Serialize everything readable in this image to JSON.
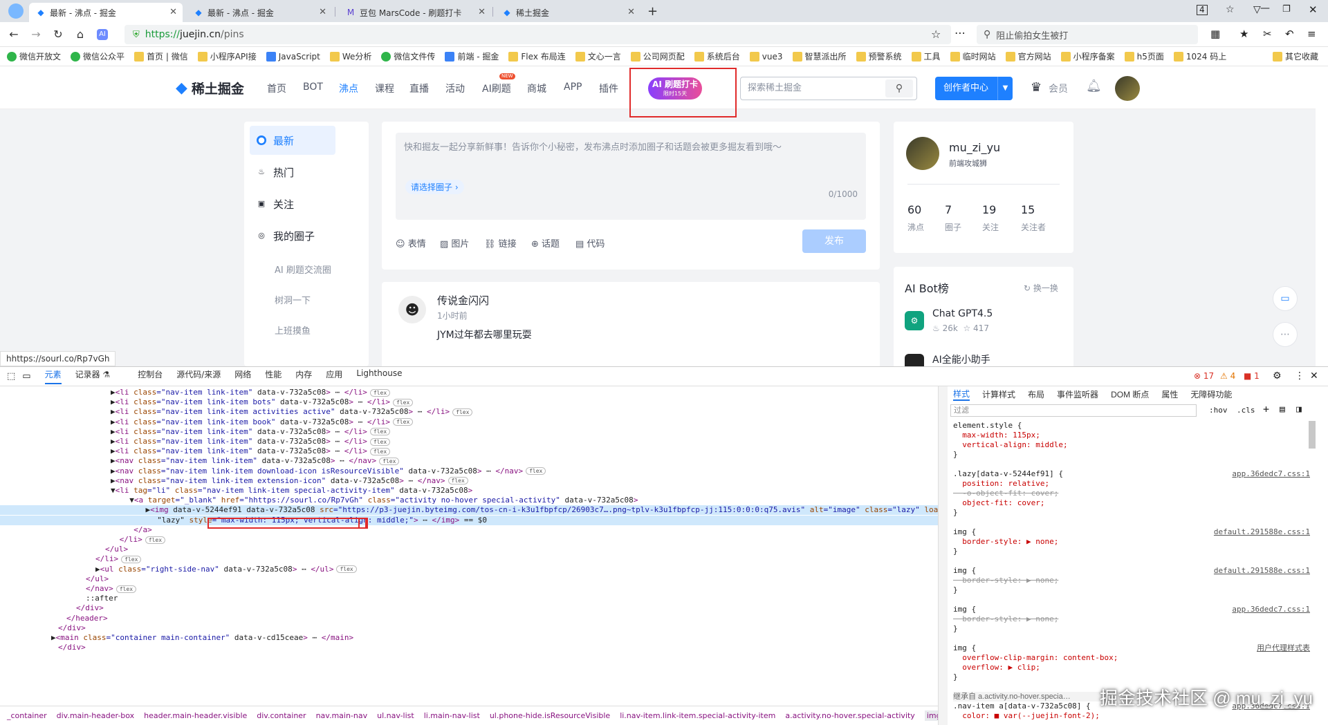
{
  "tabs": [
    {
      "label": "最新 - 沸点 - 掘金",
      "active": true
    },
    {
      "label": "最新 - 沸点 - 掘金",
      "active": false
    },
    {
      "label": "豆包 MarsCode - 刷题打卡",
      "active": false
    },
    {
      "label": "稀土掘金",
      "active": false
    }
  ],
  "address": {
    "protocol": "https://",
    "host": "juejin.cn",
    "path": "/pins",
    "search_placeholder": "阻止偷拍女生被打"
  },
  "bookmarks": [
    "微信开放文",
    "微信公众平",
    "首页 | 微信",
    "小程序API接",
    "JavaScript",
    "We分析",
    "微信文件传",
    "前端 - 掘金",
    "Flex 布局连",
    "文心一言",
    "公司网页配",
    "系统后台",
    "vue3",
    "智慧派出所",
    "预警系统",
    "工具",
    "临时网站",
    "官方网站",
    "小程序备案",
    "h5页面",
    "1024 码上",
    "其它收藏"
  ],
  "site": {
    "logo": "稀土掘金",
    "nav": [
      "首页",
      "BOT",
      "沸点",
      "课程",
      "直播",
      "活动",
      "AI刷题",
      "商城",
      "APP",
      "插件"
    ],
    "nav_active": "沸点",
    "new_badge": "NEW",
    "ai_badge": {
      "title": "AI 刷题打卡",
      "sub": "限时15天"
    },
    "search_placeholder": "探索稀土掘金",
    "creator_btn": "创作者中心",
    "vip": "会员",
    "sidebar": {
      "items": [
        "最新",
        "热门",
        "关注",
        "我的圈子"
      ],
      "sub": [
        "AI 刷题交流圈",
        "树洞一下",
        "上班摸鱼"
      ]
    },
    "composer": {
      "placeholder": "快和掘友一起分享新鲜事！告诉你个小秘密，发布沸点时添加圈子和话题会被更多掘友看到哦～",
      "circle": "请选择圈子 ›",
      "count": "0/1000",
      "tools": [
        "表情",
        "图片",
        "链接",
        "话题",
        "代码"
      ],
      "publish": "发布"
    },
    "post": {
      "author": "传说金闪闪",
      "time": "1小时前",
      "content": "JYM过年都去哪里玩耍"
    },
    "profile": {
      "name": "mu_zi_yu",
      "title": "前端攻城狮",
      "stats": [
        {
          "v": "60",
          "l": "沸点"
        },
        {
          "v": "7",
          "l": "圈子"
        },
        {
          "v": "19",
          "l": "关注"
        },
        {
          "v": "15",
          "l": "关注者"
        }
      ]
    },
    "bots": {
      "title": "AI Bot榜",
      "refresh": "换一换",
      "items": [
        {
          "name": "Chat GPT4.5",
          "hot": "26k",
          "star": "417"
        },
        {
          "name": "AI全能小助手",
          "hot": "",
          "star": ""
        }
      ]
    }
  },
  "status_url": "hhttps://sourl.co/Rp7vGh",
  "devtools": {
    "tabs": [
      "元素",
      "记录器 ⚗",
      "控制台",
      "源代码/来源",
      "网络",
      "性能",
      "内存",
      "应用",
      "Lighthouse"
    ],
    "errors": "17",
    "warnings": "4",
    "info": "1",
    "style_tabs": [
      "样式",
      "计算样式",
      "布局",
      "事件监听器",
      "DOM 断点",
      "属性",
      "无障碍功能"
    ],
    "filter_placeholder": "过滤",
    "hov": ":hov",
    "cls": ".cls",
    "crumbs": [
      "_container",
      "div.main-header-box",
      "header.main-header.visible",
      "div.container",
      "nav.main-nav",
      "ul.nav-list",
      "li.main-nav-list",
      "ul.phone-hide.isResourceVisible",
      "li.nav-item.link-item.special-activity-item",
      "a.activity.no-hover.special-activity",
      "img.lazy"
    ],
    "code": [
      "▶<li class=\"nav-item link-item\" data-v-732a5c08> ⋯ </li>",
      "▶<li class=\"nav-item link-item bots\" data-v-732a5c08> ⋯ </li>",
      "▶<li class=\"nav-item link-item activities active\" data-v-732a5c08> ⋯ </li>",
      "▶<li class=\"nav-item link-item book\" data-v-732a5c08> ⋯ </li>",
      "▶<li class=\"nav-item link-item\" data-v-732a5c08> ⋯ </li>",
      "▶<li class=\"nav-item link-item\" data-v-732a5c08> ⋯ </li>",
      "▶<li class=\"nav-item link-item\" data-v-732a5c08> ⋯ </li>",
      "▶<nav class=\"nav-item link-item\" data-v-732a5c08> ⋯ </nav>",
      "▶<nav class=\"nav-item link-item download-icon isResourceVisible\" data-v-732a5c08> ⋯ </nav>",
      "▶<nav class=\"nav-item link-item extension-icon\" data-v-732a5c08> ⋯ </nav>",
      "▼<li tag=\"li\" class=\"nav-item link-item special-activity-item\" data-v-732a5c08>",
      "  ▼<a target=\"_blank\" href=\"hhttps://sourl.co/Rp7vGh\" class=\"activity no-hover special-activity\" data-v-732a5c08>",
      "    ▶<img data-v-5244ef91 data-v-732a5c08 src=\"https://p3-juejin.byteimg.com/tos-cn-i-k3u1fbpfcp/26903c7….png~tplv-k3u1fbpfcp-jj:115:0:0:0:q75.avis\" alt=\"image\" class=\"lazy\" loading=",
      "     \"lazy\" style=\"max-width: 115px; vertical-align: middle;\"> ⋯ </img> == $0",
      "  </a>",
      " </li>",
      "</ul>",
      "</li>",
      "▶<ul class=\"right-side-nav\" data-v-732a5c08> ⋯ </ul>",
      "</ul>",
      "</nav>",
      "::after",
      "</div>",
      "</header>",
      "</div>",
      "▶<main class=\"container main-container\" data-v-cd15ceae> ⋯ </main>",
      "</div>"
    ],
    "styles": [
      {
        "t": "sel",
        "text": "element.style {"
      },
      {
        "t": "prop",
        "text": "  max-width: 115px;"
      },
      {
        "t": "prop",
        "text": "  vertical-align: middle;"
      },
      {
        "t": "close",
        "text": "}"
      },
      {
        "t": "sel",
        "text": ".lazy[data-v-5244ef91] {",
        "src": "app.36dedc7.css:1"
      },
      {
        "t": "prop",
        "text": "  position: relative;"
      },
      {
        "t": "strike",
        "text": "  -o-object-fit: cover;"
      },
      {
        "t": "prop",
        "text": "  object-fit: cover;"
      },
      {
        "t": "close",
        "text": "}"
      },
      {
        "t": "sel",
        "text": "img {",
        "src": "default.291588e.css:1"
      },
      {
        "t": "prop",
        "text": "  border-style: ▶ none;"
      },
      {
        "t": "close",
        "text": "}"
      },
      {
        "t": "sel",
        "text": "img {",
        "src": "default.291588e.css:1"
      },
      {
        "t": "strike",
        "text": "  border-style: ▶ none;"
      },
      {
        "t": "close",
        "text": "}"
      },
      {
        "t": "sel",
        "text": "img {",
        "src": "app.36dedc7.css:1"
      },
      {
        "t": "strike",
        "text": "  border-style: ▶ none;"
      },
      {
        "t": "close",
        "text": "}"
      },
      {
        "t": "sel",
        "text": "img {",
        "src": "用户代理样式表"
      },
      {
        "t": "prop",
        "text": "  overflow-clip-margin: content-box;"
      },
      {
        "t": "prop",
        "text": "  overflow: ▶ clip;"
      },
      {
        "t": "close",
        "text": "}"
      },
      {
        "t": "inh",
        "text": "继承自 a.activity.no-hover.specia…"
      },
      {
        "t": "sel",
        "text": ".nav-item a[data-v-732a5c08] {",
        "src": "app.36dedc7.css:1"
      },
      {
        "t": "prop",
        "text": "  color: ■ var(--juejin-font-2);"
      }
    ]
  },
  "watermark": "掘金技术社区 @ mu_zi_yu"
}
